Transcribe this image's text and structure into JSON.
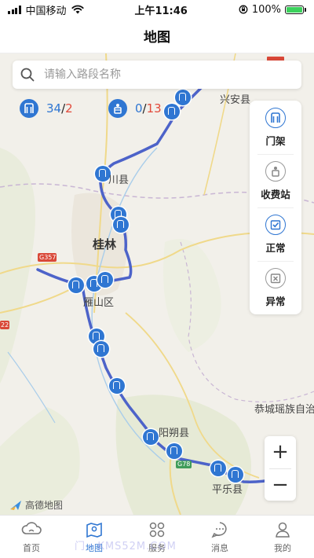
{
  "status_bar": {
    "carrier": "中国移动",
    "time": "上午11:46",
    "battery": "100%"
  },
  "nav": {
    "title": "地图"
  },
  "search": {
    "placeholder": "请输入路段名称"
  },
  "counters": {
    "gantry": {
      "normal": "34",
      "slash": "/",
      "abnormal": "2"
    },
    "toll": {
      "normal": "0",
      "slash": "/",
      "abnormal": "13"
    }
  },
  "legend": [
    {
      "label": "门架",
      "icon": "gantry-icon"
    },
    {
      "label": "收费站",
      "icon": "toll-station-icon"
    },
    {
      "label": "正常",
      "icon": "normal-status-icon"
    },
    {
      "label": "异常",
      "icon": "abnormal-status-icon"
    }
  ],
  "map_labels": {
    "xingan": "兴安县",
    "lingchuan": "川县",
    "guilin": "桂林",
    "yanshan": "雁山区",
    "yangshuo": "阳朔县",
    "pingle": "平乐县",
    "gongcheng": "恭城瑶族自治",
    "road_g357": "G357",
    "road_g78": "G78",
    "road_22": "22"
  },
  "map_logo": "高德地图",
  "zoom": {
    "in": "+",
    "out": "−"
  },
  "tabs": [
    {
      "label": "首页",
      "icon": "home-cloud-icon"
    },
    {
      "label": "地图",
      "icon": "map-icon"
    },
    {
      "label": "服务",
      "icon": "services-grid-icon"
    },
    {
      "label": "消息",
      "icon": "message-icon"
    },
    {
      "label": "我的",
      "icon": "profile-icon"
    }
  ],
  "watermark": "门 ·  KMS52M.COM",
  "colors": {
    "accent": "#2f76d2",
    "route": "#4d63c9",
    "abnormal": "#e24a3b",
    "battery": "#3bd15c"
  }
}
